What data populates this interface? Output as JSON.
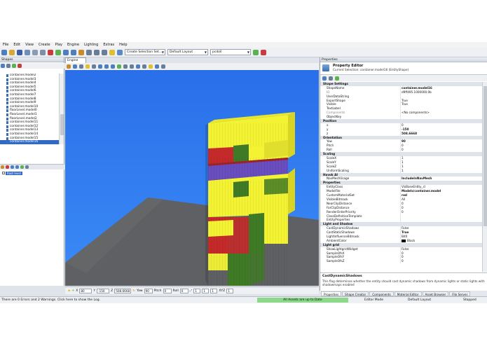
{
  "menu": [
    "File",
    "Edit",
    "View",
    "Create",
    "Play",
    "Engine",
    "Lighting",
    "Extras",
    "Help"
  ],
  "toolbar": {
    "selection_set": "Create Selection Set...",
    "layout": "Default Layout",
    "search": "pcdoll"
  },
  "shapes_panel": {
    "title": "Shapes",
    "items": [
      "container.model2",
      "container.model3",
      "container.model4",
      "container.model5",
      "container.model6",
      "container.model7",
      "container.model8",
      "container.model9",
      "container.model10",
      "floorLevel.model0",
      "floorLevel.model1",
      "floorLevel.model2",
      "container.model11",
      "container.model12",
      "container.model13",
      "container.model14",
      "container.model15",
      "container.model16"
    ],
    "selected_index": 17,
    "layer_root": "Root level"
  },
  "engine_view": {
    "tab": "Engine View"
  },
  "transform_bar": {
    "x_label": "X",
    "x": "80",
    "y_label": "Y",
    "y": "-150",
    "z_label": "Z",
    "z": "508.6668",
    "yaw_label": "Yaw",
    "yaw": "90",
    "pitch_label": "Pitch",
    "pitch": "0",
    "roll_label": "Roll",
    "roll": "0",
    "v1": "1",
    "v2": "1",
    "v3": "1",
    "xyz_label": "XYZ",
    "xyz": "1"
  },
  "properties": {
    "panel_title": "Properties",
    "editor_title": "Property Editor",
    "editor_subtitle": "Current Selection: container.model16 (EntityShape)",
    "rows": [
      {
        "k": "Shape Settings",
        "cat": true
      },
      {
        "k": "ShapeName",
        "v": "container.model16",
        "b": true
      },
      {
        "k": "ID",
        "v": "d9ff495.1000000.0b",
        "dis": true
      },
      {
        "k": "UserDataString",
        "v": ""
      },
      {
        "k": "ExportShape",
        "v": "True"
      },
      {
        "k": "Visible",
        "v": "True"
      },
      {
        "k": "TextLabel",
        "v": ""
      },
      {
        "k": "Components",
        "v": "<No components>",
        "dis": true
      },
      {
        "k": "ObjectKey",
        "v": ""
      },
      {
        "k": "Position",
        "cat": true
      },
      {
        "k": "x",
        "v": "0"
      },
      {
        "k": "y",
        "v": "-150",
        "b": true
      },
      {
        "k": "z",
        "v": "508.6668",
        "b": true
      },
      {
        "k": "Orientation",
        "cat": true
      },
      {
        "k": "Yaw",
        "v": "90",
        "b": true
      },
      {
        "k": "Pitch",
        "v": "0"
      },
      {
        "k": "Roll",
        "v": "0"
      },
      {
        "k": "Scaling",
        "cat": true
      },
      {
        "k": "ScaleX",
        "v": "1"
      },
      {
        "k": "ScaleY",
        "v": "1"
      },
      {
        "k": "ScaleZ",
        "v": "1"
      },
      {
        "k": "UniformScaling",
        "v": "1"
      },
      {
        "k": "Havok AI",
        "cat": true
      },
      {
        "k": "NavMeshUsage",
        "v": "IncludeInNavMesh",
        "b": true
      },
      {
        "k": "Properties",
        "cat": true
      },
      {
        "k": "EntityClass",
        "v": "VisBaseEntity_cl"
      },
      {
        "k": "ModelFile",
        "v": "Models/container.model",
        "b": true
      },
      {
        "k": "CustomMaterialSet",
        "v": "red",
        "b": true
      },
      {
        "k": "VisibleBitmask",
        "v": "All"
      },
      {
        "k": "NearClipDistance",
        "v": "0"
      },
      {
        "k": "FarClipDistance",
        "v": "0"
      },
      {
        "k": "RenderOrderPriority",
        "v": "0"
      },
      {
        "k": "ClassDefinitionTemplate",
        "v": ""
      },
      {
        "k": "EntityProperties",
        "v": ""
      },
      {
        "k": "Light and Shadow",
        "cat": true
      },
      {
        "k": "CastDynamicShadows",
        "v": "False"
      },
      {
        "k": "CastStaticShadows",
        "v": "True",
        "b": true
      },
      {
        "k": "LightInfluenceBitmask",
        "v": "Bit0"
      },
      {
        "k": "AmbientColor",
        "v": "Black",
        "swatch": "#000000"
      },
      {
        "k": "Light grid",
        "cat": true
      },
      {
        "k": "ShowLightgridWidget",
        "v": "False"
      },
      {
        "k": "SampleOfsX",
        "v": "0"
      },
      {
        "k": "SampleOfsY",
        "v": "0"
      },
      {
        "k": "SampleOfsZ",
        "v": "0"
      }
    ],
    "desc_title": "CastDynamicShadows",
    "desc_text": "This flag determines whether the entity should cast dynamic shadows from dynamic lights or static lights with shadowmaps enabled"
  },
  "bottom_tabs": [
    {
      "label": "Properties",
      "active": true
    },
    {
      "label": "Shape Creator",
      "active": false
    },
    {
      "label": "Components",
      "active": false
    },
    {
      "label": "Material Editor",
      "active": false
    },
    {
      "label": "Asset Browser",
      "active": false
    },
    {
      "label": "File Server",
      "active": false
    }
  ],
  "status": {
    "errors": "There are 0 Errors and 2 Warnings. Click here to show the Log.",
    "assets": "All Assets are up to Date",
    "play_mode": "Editor Mode",
    "layout": "Default Layout",
    "state": "Stopped"
  },
  "colors": {
    "sky": "#2d78f0",
    "ground": "#5f6063",
    "yellow": "#f3f233",
    "red": "#c52a2a",
    "green": "#3f7a26",
    "purple": "#6a4dbf",
    "selection": "#316ac5"
  }
}
